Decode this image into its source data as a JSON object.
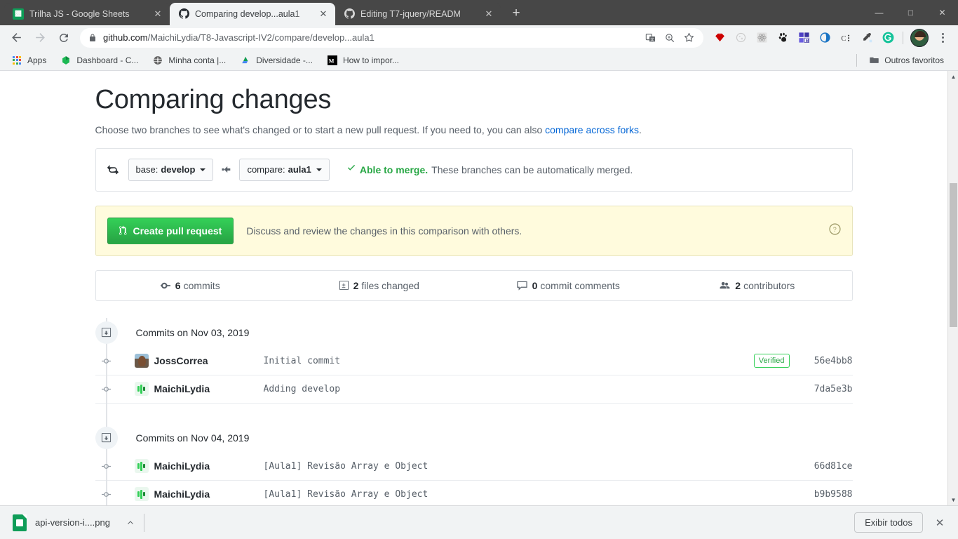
{
  "browser": {
    "tabs": [
      {
        "title": "Trilha JS - Google Sheets",
        "favicon": "google-sheets-icon",
        "active": false
      },
      {
        "title": "Comparing develop...aula1",
        "favicon": "github-icon",
        "active": true
      },
      {
        "title": "Editing T7-jquery/READM",
        "favicon": "github-icon",
        "active": false
      }
    ],
    "new_tab_label": "+",
    "window_controls": {
      "minimize": "—",
      "maximize": "□",
      "close": "✕"
    },
    "toolbar": {
      "back_label": "←",
      "forward_label": "→",
      "reload_label": "↻",
      "url_domain": "github.com",
      "url_path": "/MaichiLydia/T8-Javascript-IV2/compare/develop...aula1",
      "lock_icon": "lock-icon",
      "translate_icon": "translate-icon",
      "zoom_icon": "zoom-magnifier-icon",
      "bookmark_icon": "star-icon",
      "extensions": [
        "ruby-extension-icon",
        "moon-extension-icon",
        "react-devtools-icon",
        "gnome-extension-icon",
        "metamask-icon",
        "blue-swirl-extension-icon",
        "colorzilla-icon",
        "eyedropper-icon",
        "grammarly-icon"
      ],
      "profile_icon": "profile-avatar",
      "menu_icon": "kebab-menu-icon"
    },
    "bookmarks": {
      "items": [
        {
          "label": "Apps",
          "icon": "apps-grid-icon"
        },
        {
          "label": "Dashboard - C...",
          "icon": "green-hexagon-icon"
        },
        {
          "label": "Minha conta |...",
          "icon": "globe-icon"
        },
        {
          "label": "Diversidade -...",
          "icon": "google-drive-icon"
        },
        {
          "label": "How to impor...",
          "icon": "medium-icon"
        }
      ],
      "other_label": "Outros favoritos",
      "other_icon": "folder-icon"
    },
    "downloads": {
      "file_name": "api-version-i....png",
      "file_icon": "image-file-icon",
      "expand_icon": "chevron-up-icon",
      "show_all_label": "Exibir todos",
      "close_icon": "close-icon"
    },
    "scrollbar": {
      "up_arrow": "▲",
      "down_arrow": "▼"
    }
  },
  "page": {
    "title": "Comparing changes",
    "subtitle_before": "Choose two branches to see what's changed or to start a new pull request. If you need to, you can also ",
    "subtitle_link": "compare across forks",
    "subtitle_after": ".",
    "compare_bar": {
      "swap_icon": "swap-branches-icon",
      "base_prefix": "base:",
      "base_branch": "develop",
      "arrow_icon": "arrow-left-icon",
      "compare_prefix": "compare:",
      "compare_branch": "aula1",
      "merge_check_icon": "check-icon",
      "merge_status": "Able to merge.",
      "merge_detail": "These branches can be automatically merged."
    },
    "pr_banner": {
      "button_icon": "git-pull-request-icon",
      "button_label": "Create pull request",
      "description": "Discuss and review the changes in this comparison with others.",
      "help_icon": "question-circle-icon"
    },
    "stats": [
      {
        "icon": "commit-icon",
        "count": "6",
        "label": "commits"
      },
      {
        "icon": "file-diff-icon",
        "count": "2",
        "label": "files changed"
      },
      {
        "icon": "comment-icon",
        "count": "0",
        "label": "commit comments"
      },
      {
        "icon": "people-icon",
        "count": "2",
        "label": "contributors"
      }
    ],
    "commit_groups": [
      {
        "group_icon": "commit-group-icon",
        "label": "Commits on Nov 03, 2019",
        "commits": [
          {
            "avatar": "joss-avatar",
            "author": "JossCorrea",
            "message": "Initial commit",
            "verified": "Verified",
            "sha": "56e4bb8"
          },
          {
            "avatar": "lydia-avatar",
            "author": "MaichiLydia",
            "message": "Adding develop",
            "verified": "",
            "sha": "7da5e3b"
          }
        ]
      },
      {
        "group_icon": "commit-group-icon",
        "label": "Commits on Nov 04, 2019",
        "commits": [
          {
            "avatar": "lydia-avatar",
            "author": "MaichiLydia",
            "message": "[Aula1] Revisão Array e Object",
            "verified": "",
            "sha": "66d81ce"
          },
          {
            "avatar": "lydia-avatar",
            "author": "MaichiLydia",
            "message": "[Aula1] Revisão Array e Object",
            "verified": "",
            "sha": "b9b9588"
          }
        ]
      }
    ]
  },
  "colors": {
    "green_accent": "#28a745",
    "link_blue": "#0366d6",
    "banner_yellow": "#fffbdd",
    "border_gray": "#e1e4e8",
    "text_dark": "#24292e",
    "text_muted": "#586069"
  }
}
